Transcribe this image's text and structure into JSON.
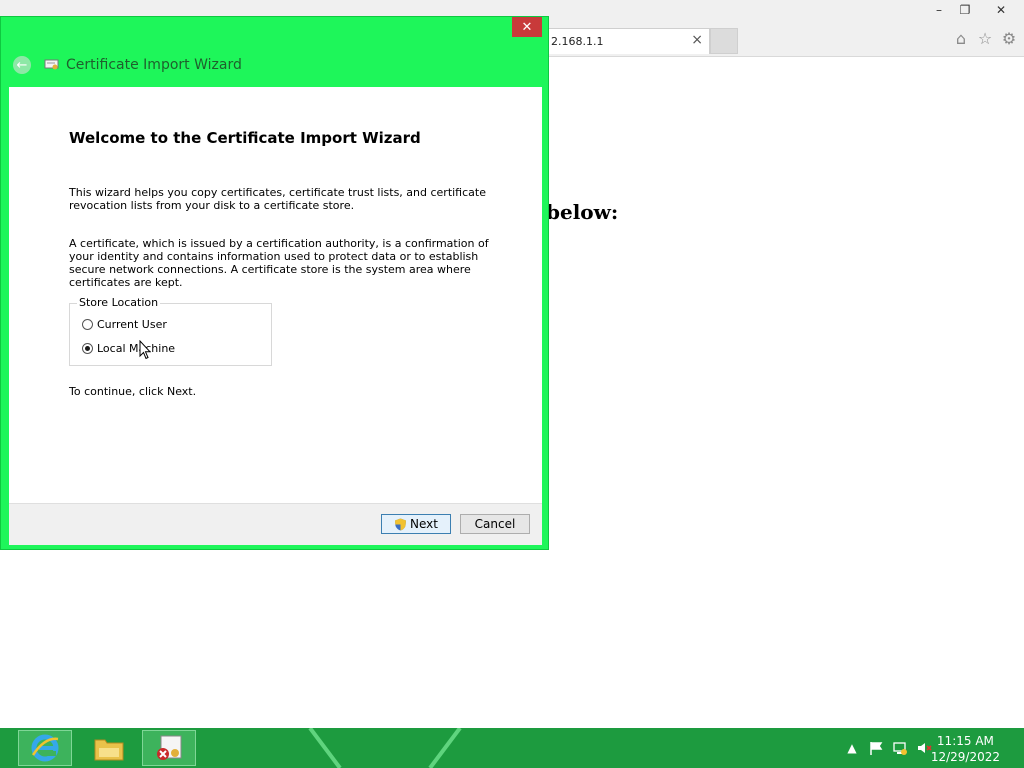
{
  "browser": {
    "tab_title": "2.168.1.1",
    "tab_close": "×",
    "page_heading": "below:",
    "caption": {
      "minimize": "–",
      "restore": "❐",
      "close": "✕"
    },
    "tools": {
      "home": "⌂",
      "favorites": "☆",
      "settings": "⚙"
    }
  },
  "dialog": {
    "title": "Certificate Import Wizard",
    "close": "✕",
    "back": "←",
    "heading": "Welcome to the Certificate Import Wizard",
    "para1": "This wizard helps you copy certificates, certificate trust lists, and certificate revocation lists from your disk to a certificate store.",
    "para2": "A certificate, which is issued by a certification authority, is a confirmation of your identity and contains information used to protect data or to establish secure network connections. A certificate store is the system area where certificates are kept.",
    "store_location": {
      "label": "Store Location",
      "options": [
        {
          "label": "Current User",
          "selected": false
        },
        {
          "label": "Local Machine",
          "selected": true
        }
      ]
    },
    "continue_text": "To continue, click Next.",
    "buttons": {
      "next": "Next",
      "cancel": "Cancel"
    }
  },
  "taskbar": {
    "apps": [
      "internet-explorer",
      "file-explorer",
      "certificate-import-wizard"
    ],
    "tray": {
      "show_hidden": "▲"
    },
    "clock": {
      "time": "11:15 AM",
      "date": "12/29/2022"
    }
  },
  "colors": {
    "dialog_frame": "#1ef65a",
    "taskbar": "#1d9b3f",
    "close_button": "#c83a3a"
  }
}
